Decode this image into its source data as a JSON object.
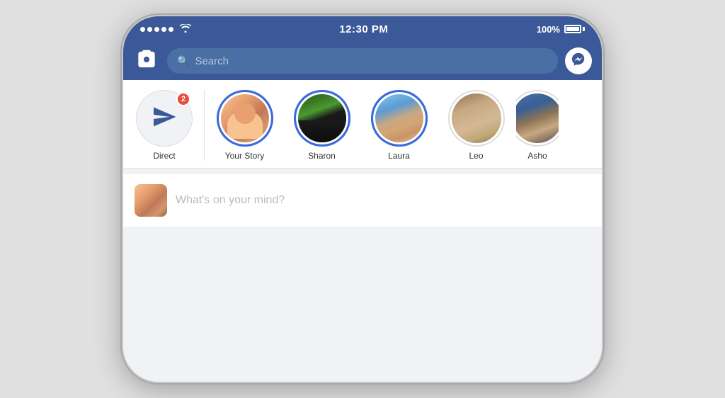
{
  "statusBar": {
    "time": "12:30 PM",
    "battery": "100%",
    "signalDots": 5
  },
  "navBar": {
    "searchPlaceholder": "Search",
    "cameraLabel": "camera",
    "messengerLabel": "messenger"
  },
  "stories": {
    "items": [
      {
        "id": "direct",
        "label": "Direct",
        "badge": "2",
        "type": "direct"
      },
      {
        "id": "your-story",
        "label": "Your Story",
        "type": "avatar",
        "ring": true
      },
      {
        "id": "sharon",
        "label": "Sharon",
        "type": "avatar",
        "ring": true
      },
      {
        "id": "laura",
        "label": "Laura",
        "type": "avatar",
        "ring": true
      },
      {
        "id": "leo",
        "label": "Leo",
        "type": "avatar",
        "ring": false
      },
      {
        "id": "ash",
        "label": "Asho",
        "type": "avatar",
        "ring": false
      }
    ]
  },
  "composer": {
    "placeholder": "What's on your mind?"
  }
}
